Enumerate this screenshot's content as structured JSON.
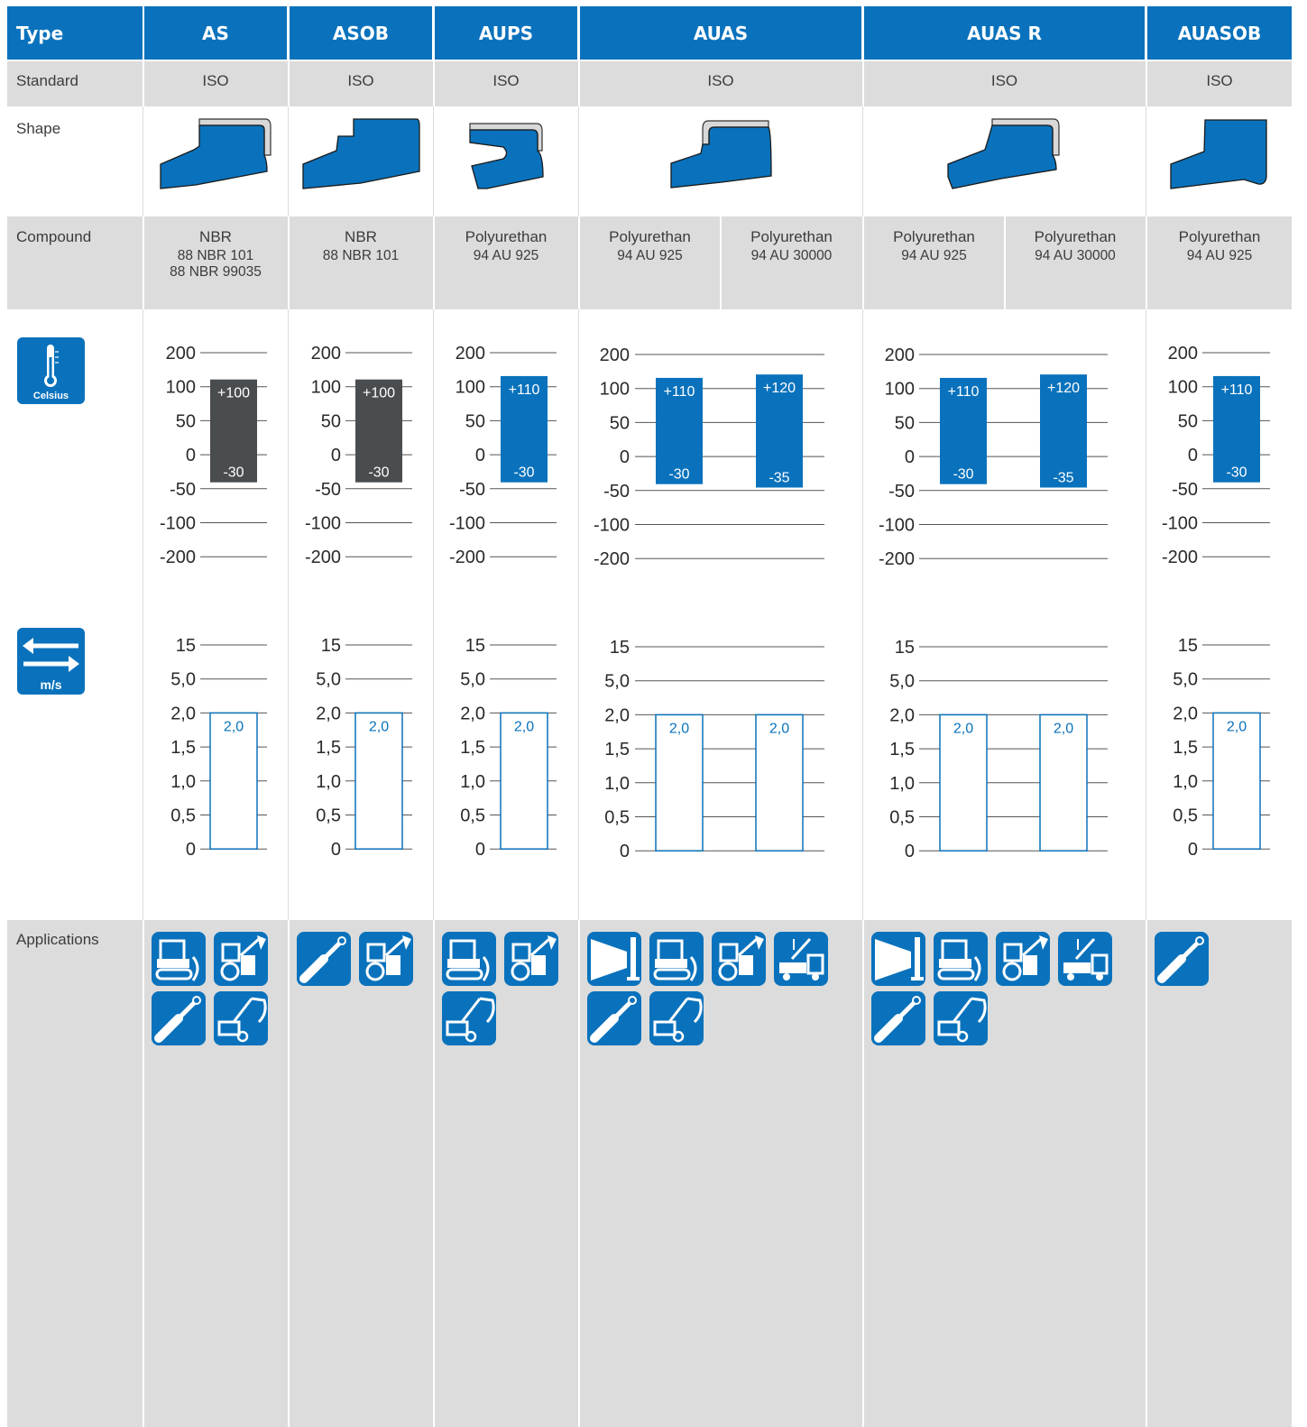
{
  "header": {
    "type_label": "Type",
    "columns": [
      "AS",
      "ASOB",
      "AUPS",
      "AUAS",
      "AUAS R",
      "AUASOB"
    ]
  },
  "rows": {
    "standard_label": "Standard",
    "shape_label": "Shape",
    "compound_label": "Compound",
    "applications_label": "Applications"
  },
  "standards": [
    "ISO",
    "ISO",
    "ISO",
    "ISO",
    "ISO",
    "ISO"
  ],
  "compounds": [
    {
      "name": "NBR",
      "codes": [
        "88 NBR 101",
        "88 NBR 99035"
      ]
    },
    {
      "name": "NBR",
      "codes": [
        "88 NBR 101"
      ]
    },
    {
      "name": "Polyurethan",
      "codes": [
        "94 AU 925"
      ]
    },
    {
      "name": "Polyurethan",
      "codes": [
        "94 AU 925"
      ]
    },
    {
      "name": "Polyurethan",
      "codes": [
        "94  AU 30000"
      ]
    },
    {
      "name": "Polyurethan",
      "codes": [
        "94 AU 925"
      ]
    },
    {
      "name": "Polyurethan",
      "codes": [
        "94  AU 30000"
      ]
    },
    {
      "name": "Polyurethan",
      "codes": [
        "94 AU 925"
      ]
    }
  ],
  "icons": {
    "temperature": {
      "name": "thermometer-icon",
      "label": "Celsius"
    },
    "speed": {
      "name": "arrows-icon",
      "label": "m/s"
    }
  },
  "colors": {
    "brand_blue": "#0a72bc",
    "nbr_dark": "#4a4d50",
    "grey_bg": "#dcdcdc"
  },
  "chart_data": [
    {
      "type": "bar",
      "title": "",
      "ylabel": "",
      "ticks": [
        "200",
        "100",
        "50",
        "0",
        "-50",
        "-100",
        "-200"
      ],
      "series": [
        {
          "column": "AS",
          "compound": "88 NBR 101",
          "min": -30,
          "max": 100,
          "max_label": "+100",
          "min_label": "-30",
          "color": "#4a4d50"
        },
        {
          "column": "ASOB",
          "compound": "88 NBR 101",
          "min": -30,
          "max": 100,
          "max_label": "+100",
          "min_label": "-30",
          "color": "#4a4d50"
        },
        {
          "column": "AUPS",
          "compound": "94 AU 925",
          "min": -30,
          "max": 110,
          "max_label": "+110",
          "min_label": "-30",
          "color": "#0a72bc"
        },
        {
          "column": "AUAS",
          "compound": "94 AU 925",
          "min": -30,
          "max": 110,
          "max_label": "+110",
          "min_label": "-30",
          "color": "#0a72bc"
        },
        {
          "column": "AUAS",
          "compound": "94  AU 30000",
          "min": -35,
          "max": 120,
          "max_label": "+120",
          "min_label": "-35",
          "color": "#0a72bc"
        },
        {
          "column": "AUAS R",
          "compound": "94 AU 925",
          "min": -30,
          "max": 110,
          "max_label": "+110",
          "min_label": "-30",
          "color": "#0a72bc"
        },
        {
          "column": "AUAS R",
          "compound": "94  AU 30000",
          "min": -35,
          "max": 120,
          "max_label": "+120",
          "min_label": "-35",
          "color": "#0a72bc"
        },
        {
          "column": "AUASOB",
          "compound": "94 AU 925",
          "min": -30,
          "max": 110,
          "max_label": "+110",
          "min_label": "-30",
          "color": "#0a72bc"
        }
      ]
    },
    {
      "type": "bar",
      "title": "",
      "ylabel": "",
      "ticks": [
        "15",
        "5,0",
        "2,0",
        "1,5",
        "1,0",
        "0,5",
        "0"
      ],
      "series": [
        {
          "column": "AS",
          "compound": "88 NBR 101",
          "value": 2.0,
          "label": "2,0"
        },
        {
          "column": "ASOB",
          "compound": "88 NBR 101",
          "value": 2.0,
          "label": "2,0"
        },
        {
          "column": "AUPS",
          "compound": "94 AU 925",
          "value": 2.0,
          "label": "2,0"
        },
        {
          "column": "AUAS",
          "compound": "94 AU 925",
          "value": 2.0,
          "label": "2,0"
        },
        {
          "column": "AUAS",
          "compound": "94  AU 30000",
          "value": 2.0,
          "label": "2,0"
        },
        {
          "column": "AUAS R",
          "compound": "94 AU 925",
          "value": 2.0,
          "label": "2,0"
        },
        {
          "column": "AUAS R",
          "compound": "94  AU 30000",
          "value": 2.0,
          "label": "2,0"
        },
        {
          "column": "AUASOB",
          "compound": "94 AU 925",
          "value": 2.0,
          "label": "2,0"
        }
      ]
    }
  ],
  "applications": [
    [
      "bulldozer-icon",
      "wheel-loader-icon",
      "cylinder-icon",
      "excavator-icon"
    ],
    [
      "cylinder-icon",
      "wheel-loader-icon"
    ],
    [
      "bulldozer-icon",
      "wheel-loader-icon",
      "excavator-icon"
    ],
    [
      "press-icon",
      "bulldozer-icon",
      "wheel-loader-icon",
      "crane-truck-icon",
      "cylinder-icon",
      "excavator-icon"
    ],
    [
      "press-icon",
      "bulldozer-icon",
      "wheel-loader-icon",
      "crane-truck-icon",
      "cylinder-icon",
      "excavator-icon"
    ],
    [
      "cylinder-icon"
    ]
  ]
}
